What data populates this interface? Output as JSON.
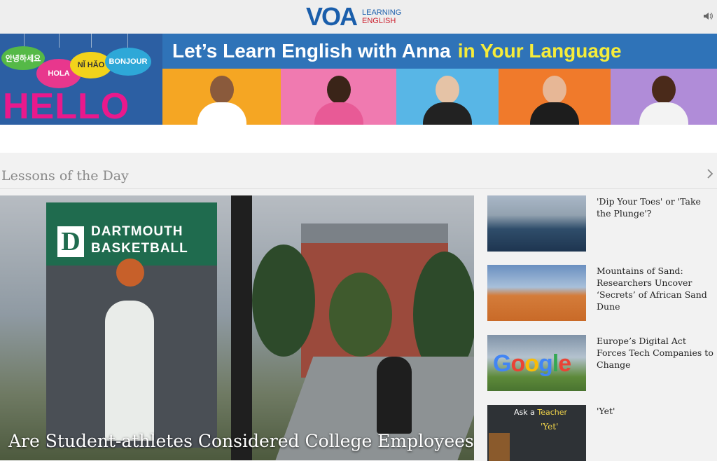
{
  "header": {
    "logo_mark": "VOA",
    "logo_line1": "LEARNING",
    "logo_line2": "ENGLISH",
    "speaker_icon": "speaker-icon"
  },
  "banner": {
    "greetings": [
      "안녕하세요",
      "HOLA",
      "NǏ HǍO",
      "BONJOUR"
    ],
    "hello": "HELLO",
    "headline_main": "Let’s Learn English with Anna",
    "headline_highlight": "in Your Language",
    "panel_colors": [
      "#f5a623",
      "#f07ab0",
      "#58b6e6",
      "#f07a2b",
      "#b08cd8"
    ]
  },
  "section": {
    "title": "Lessons of the Day",
    "arrow_icon": "chevron-right-icon"
  },
  "hero": {
    "flag_line1": "DARTMOUTH",
    "flag_line2": "BASKETBALL",
    "flag_letter": "D",
    "caption": "Are Student-athletes Considered College Employees?"
  },
  "side_articles": [
    {
      "title": "'Dip Your Toes' or 'Take the Plunge'?"
    },
    {
      "title": "Mountains of Sand: Researchers Uncover ‘Secrets’ of African Sand Dune"
    },
    {
      "title": "Europe’s Digital Act Forces Tech Companies to Change"
    },
    {
      "title": "'Yet'",
      "thumb_text1": "Ask a",
      "thumb_text2": "Teacher",
      "thumb_text3": "'Yet'"
    }
  ]
}
